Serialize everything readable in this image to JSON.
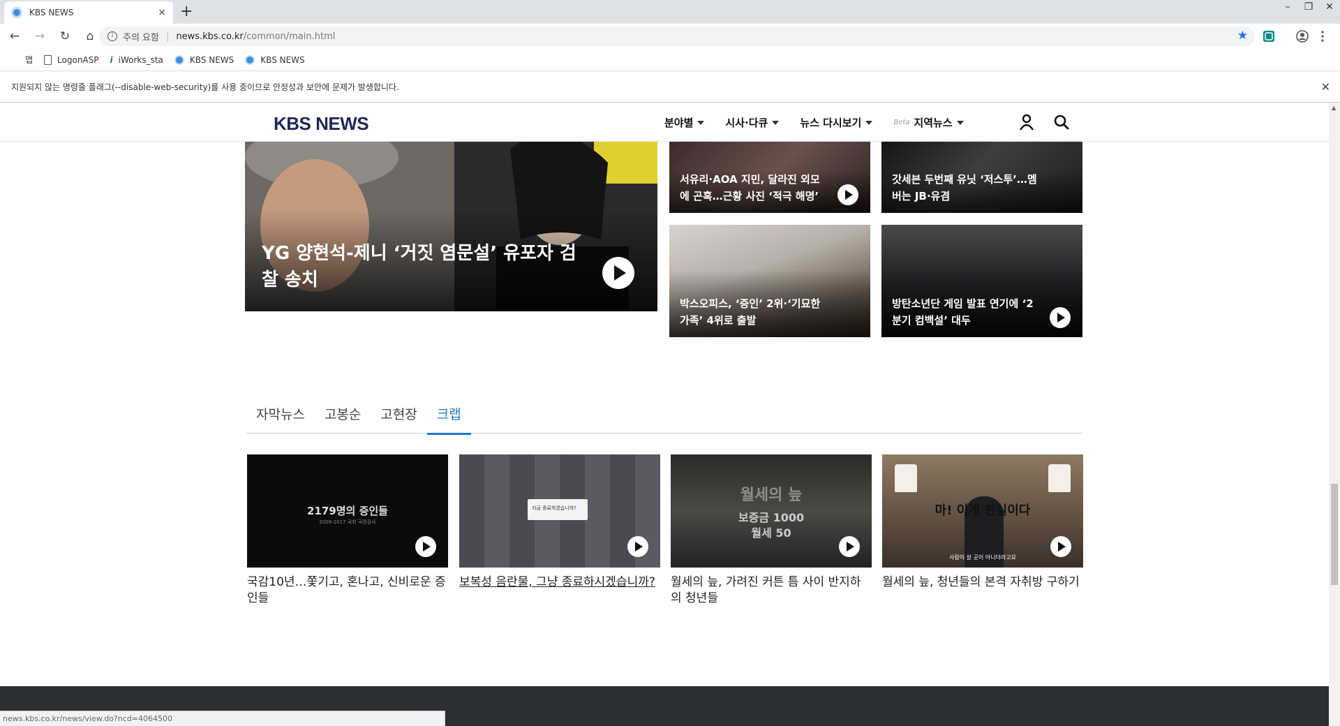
{
  "browser": {
    "tab_title": "KBS NEWS",
    "tab_close": "×",
    "new_tab": "+",
    "window_controls": [
      "–",
      "❐",
      "✕"
    ],
    "security_label": "주의 요함",
    "url_host": "news.kbs.co.kr",
    "url_path": "/common/main.html",
    "bookmarks": [
      {
        "label": "앱",
        "icon": "apps-icon"
      },
      {
        "label": "LogonASP",
        "icon": "document-icon"
      },
      {
        "label": "iWorks_sta",
        "icon": "iworks-icon"
      },
      {
        "label": "KBS NEWS",
        "icon": "kbs-favicon"
      },
      {
        "label": "KBS NEWS",
        "icon": "kbs-favicon"
      }
    ],
    "infobar_text": "지원되지 않는 명령줄 플래그(--disable-web-security)를 사용 중이므로 안정성과 보안에 문제가 발생합니다.",
    "infobar_close": "✕",
    "status_url": "news.kbs.co.kr/news/view.do?ncd=4064500"
  },
  "site": {
    "logo": "KBS NEWS",
    "nav": [
      {
        "label": "분야별",
        "beta": ""
      },
      {
        "label": "시사·다큐",
        "beta": ""
      },
      {
        "label": "뉴스 다시보기",
        "beta": ""
      },
      {
        "label": "지역뉴스",
        "beta": "Beta"
      }
    ]
  },
  "featured": {
    "main": {
      "title": "YG 양현석-제니 ‘거짓 염문설’ 유포자 검찰 송치"
    },
    "side": [
      {
        "title": "서유리·AOA 지민, 달라진 외모에 곤혹…근황 사진 ‘적극 해명’"
      },
      {
        "title": "갓세븐 두번째 유닛 ‘저스투’…멤버는 JB·유겸"
      },
      {
        "title": "박스오피스, ‘증인’ 2위·‘기묘한 가족’ 4위로 출발"
      },
      {
        "title": "방탄소년단 게임 발표 연기에 ‘2분기 컴백설’ 대두"
      }
    ]
  },
  "video_tabs": {
    "items": [
      "자막뉴스",
      "고봉순",
      "고현장",
      "크랩"
    ],
    "active_index": 3
  },
  "cards": [
    {
      "title": "국감10년…쫓기고, 혼나고, 신비로운 증인들",
      "thumb_text": "2179명의 증인들",
      "thumb_sub": "2009-2017 국회 국정감사"
    },
    {
      "title": "보복성 음란물, 그냥 종료하시겠습니까?",
      "thumb_text": "지금 종료하겠습니까?",
      "thumb_sub": ""
    },
    {
      "title": "월세의 늪, 가려진 커튼 틈 사이 반지하의 청년들",
      "thumb_text": "월세의 늪",
      "thumb_sub": "보증금 1000 월세 50"
    },
    {
      "title": "월세의 늪, 청년들의 본격 자취방 구하기",
      "thumb_text": "마! 이게 현실이다",
      "thumb_sub": "사람이 살 곳이 아니더라고요"
    }
  ],
  "colors": {
    "accent": "#1f75c5",
    "logo": "#1d2a55",
    "footer": "#2b2e33"
  }
}
